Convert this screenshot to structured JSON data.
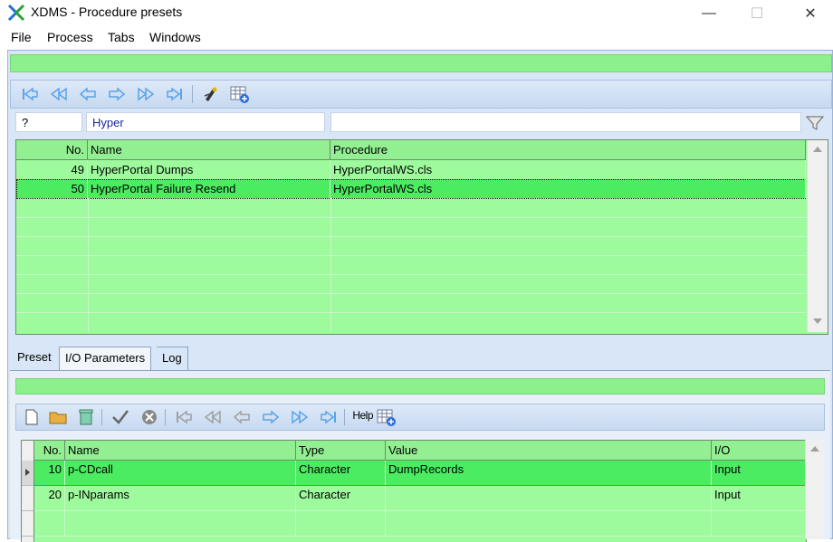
{
  "window": {
    "title": "XDMS  -  Procedure presets",
    "minimize": "—",
    "maximize": "☐",
    "close": "✕"
  },
  "menu": [
    "File",
    "Process",
    "Tabs",
    "Windows"
  ],
  "filters": {
    "number": "?",
    "name": "Hyper",
    "procedure": ""
  },
  "top_grid": {
    "columns": [
      "No.",
      "Name",
      "Procedure"
    ],
    "rows": [
      {
        "no": "49",
        "name": "HyperPortal Dumps",
        "procedure": "HyperPortalWS.cls"
      },
      {
        "no": "50",
        "name": "HyperPortal Failure Resend",
        "procedure": "HyperPortalWS.cls"
      }
    ]
  },
  "tabs": [
    "Preset",
    "I/O Parameters",
    "Log"
  ],
  "active_tab": "I/O Parameters",
  "bottom_toolbar": {
    "help_label": "Help"
  },
  "bottom_grid": {
    "columns": [
      "No.",
      "Name",
      "Type",
      "Value",
      "I/O"
    ],
    "rows": [
      {
        "no": "10",
        "name": "p-CDcall",
        "type": "Character",
        "value": "DumpRecords",
        "io": "Input"
      },
      {
        "no": "20",
        "name": "p-INparams",
        "type": "Character",
        "value": "",
        "io": "Input"
      }
    ]
  },
  "colors": {
    "grid_bg": "#9dfa9d",
    "selected_row": "#4bec62",
    "toolbar": "#d4e2f5",
    "nav_icon": "#5ba3e8"
  }
}
